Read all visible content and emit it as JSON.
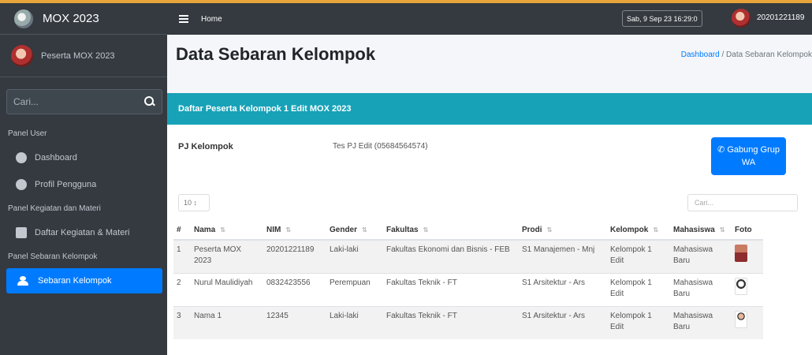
{
  "brand": {
    "title": "MOX 2023"
  },
  "user_panel": {
    "name": "Peserta MOX 2023"
  },
  "sidebar": {
    "search_placeholder": "Cari...",
    "sections": [
      {
        "header": "Panel User"
      },
      {
        "header": "Panel Kegiatan dan Materi"
      },
      {
        "header": "Panel Sebaran Kelompok"
      }
    ],
    "items": [
      {
        "label": "Dashboard",
        "icon": "dashboard-icon"
      },
      {
        "label": "Profil Pengguna",
        "icon": "user-circle-icon"
      },
      {
        "label": "Daftar Kegiatan & Materi",
        "icon": "chalkboard-icon"
      },
      {
        "label": "Sebaran Kelompok",
        "icon": "users-icon",
        "active": true
      }
    ]
  },
  "navbar": {
    "home": "Home",
    "datetime": "Sab, 9 Sep 23 16:29:0",
    "user_id": "20201221189"
  },
  "page": {
    "title": "Data Sebaran Kelompok",
    "breadcrumb_link": "Dashboard",
    "breadcrumb_current": "Data Sebaran Kelompok"
  },
  "card": {
    "title": "Daftar Peserta Kelompok 1 Edit MOX 2023",
    "pj_label": "PJ Kelompok",
    "pj_value": "Tes PJ Edit (05684564574)",
    "wa_button": "Gabung Grup WA",
    "length_select": "10",
    "search_placeholder": "Cari..."
  },
  "table": {
    "headers": [
      "#",
      "Nama",
      "NIM",
      "Gender",
      "Fakultas",
      "Prodi",
      "Kelompok",
      "Mahasiswa",
      "Foto"
    ],
    "rows": [
      {
        "no": "1",
        "nama": "Peserta MOX 2023",
        "nim": "20201221189",
        "gender": "Laki-laki",
        "fakultas": "Fakultas Ekonomi dan Bisnis - FEB",
        "prodi": "S1 Manajemen - Mnj",
        "kelompok": "Kelompok 1 Edit",
        "mahasiswa": "Mahasiswa Baru"
      },
      {
        "no": "2",
        "nama": "Nurul Maulidiyah",
        "nim": "0832423556",
        "gender": "Perempuan",
        "fakultas": "Fakultas Teknik - FT",
        "prodi": "S1 Arsitektur - Ars",
        "kelompok": "Kelompok 1 Edit",
        "mahasiswa": "Mahasiswa Baru"
      },
      {
        "no": "3",
        "nama": "Nama 1",
        "nim": "12345",
        "gender": "Laki-laki",
        "fakultas": "Fakultas Teknik - FT",
        "prodi": "S1 Arsitektur - Ars",
        "kelompok": "Kelompok 1 Edit",
        "mahasiswa": "Mahasiswa Baru"
      }
    ]
  }
}
